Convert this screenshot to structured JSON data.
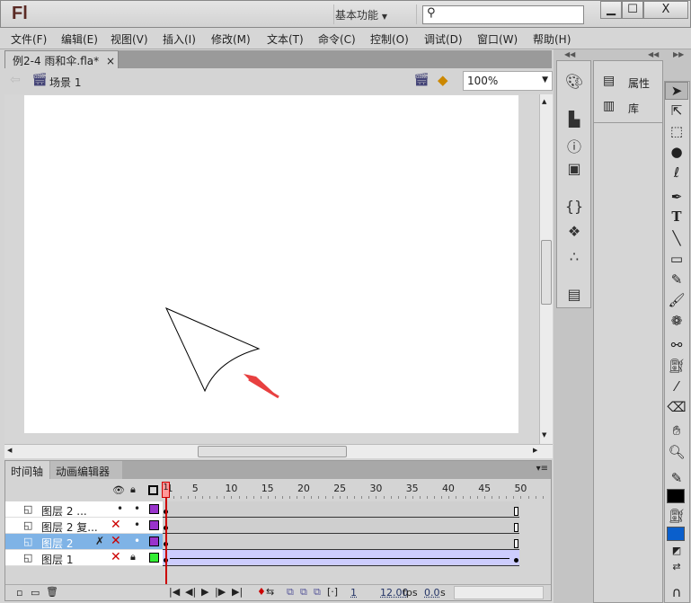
{
  "app": {
    "logo": "Fl",
    "workspace": "基本功能",
    "search_placeholder": "",
    "window_buttons": [
      "minimize",
      "maximize",
      "close"
    ]
  },
  "menu": [
    "文件(F)",
    "编辑(E)",
    "视图(V)",
    "插入(I)",
    "修改(M)",
    "文本(T)",
    "命令(C)",
    "控制(O)",
    "调试(D)",
    "窗口(W)",
    "帮助(H)"
  ],
  "document": {
    "tab": "例2-4 雨和伞.fla*",
    "close": "×",
    "scene": "场景 1",
    "zoom": "100%"
  },
  "timeline": {
    "tabs": [
      "时间轴",
      "动画编辑器"
    ],
    "ruler": [
      "1",
      "5",
      "10",
      "15",
      "20",
      "25",
      "30",
      "35",
      "40",
      "45",
      "50"
    ],
    "current_frame": 1,
    "layers": [
      {
        "name": "图层 2 ...",
        "visible": "•",
        "lock": "•",
        "color": "#9933cc",
        "selected": false,
        "tween": false
      },
      {
        "name": "图层 2 复...",
        "visible": "x",
        "lock": "•",
        "color": "#9933cc",
        "selected": false,
        "tween": false
      },
      {
        "name": "图层 2",
        "visible": "x",
        "lock": "•",
        "color": "#9933cc",
        "selected": true,
        "tween": false
      },
      {
        "name": "图层 1",
        "visible": "x",
        "lock": "lock",
        "color": "#33ee33",
        "selected": false,
        "tween": true
      }
    ],
    "status": {
      "frame": "1",
      "fps": "12.00",
      "fps_unit": "fps",
      "time": "0.0",
      "time_unit": "s"
    }
  },
  "panels": {
    "properties": "属性",
    "library": "库"
  },
  "colors": {
    "stroke": "#000000",
    "fill": "#0a5fcc",
    "accent_red": "#e84040"
  }
}
